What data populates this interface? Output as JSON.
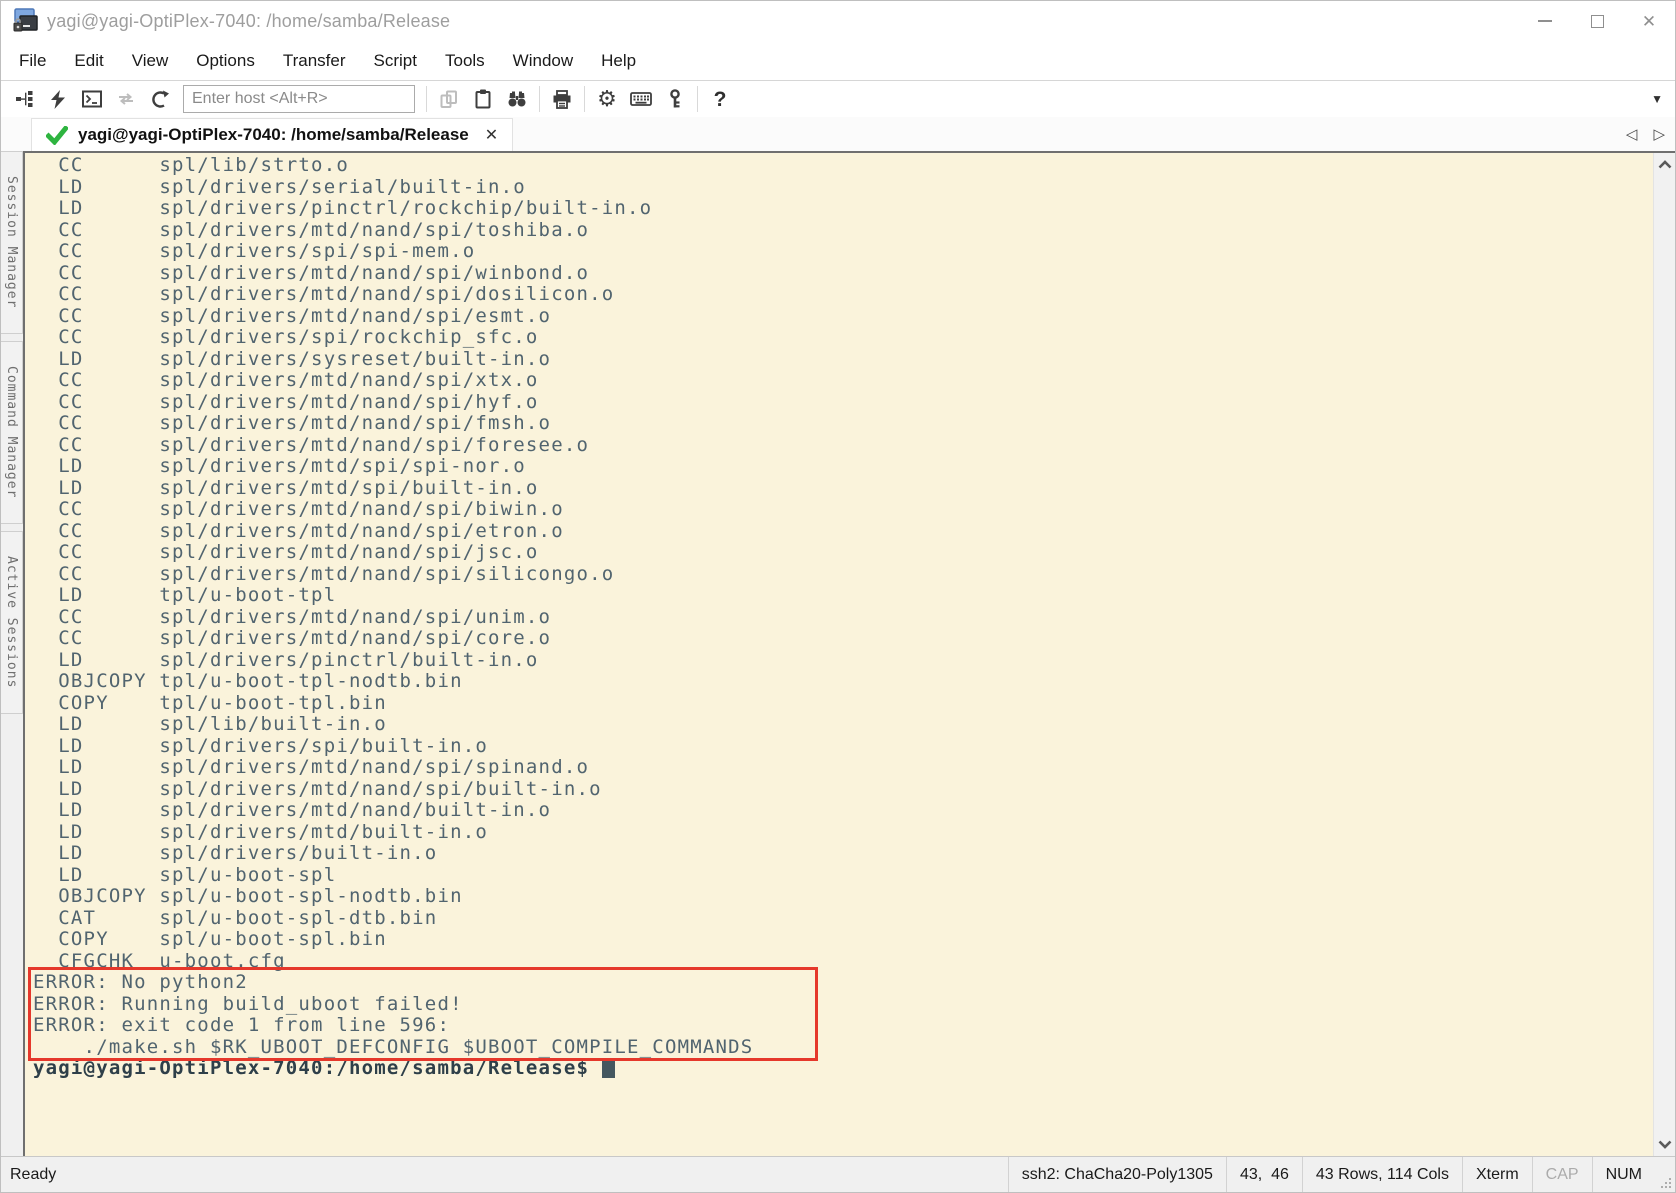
{
  "window": {
    "title": "yagi@yagi-OptiPlex-7040: /home/samba/Release"
  },
  "menu": {
    "items": [
      "File",
      "Edit",
      "View",
      "Options",
      "Transfer",
      "Script",
      "Tools",
      "Window",
      "Help"
    ]
  },
  "toolbar": {
    "host_placeholder": "Enter host <Alt+R>",
    "icons": [
      "sessions-dialog",
      "quick-connect",
      "new-terminal",
      "reconnect",
      "disconnect",
      "copy",
      "paste",
      "find",
      "print",
      "session-properties-gear",
      "keyboard-input",
      "key-agent",
      "help"
    ]
  },
  "tabbar": {
    "active_tab": {
      "label": "yagi@yagi-OptiPlex-7040: /home/samba/Release",
      "status": "connected"
    }
  },
  "sidebar": {
    "items": [
      {
        "label": "Session Manager"
      },
      {
        "label": "Command Manager"
      },
      {
        "label": "Active Sessions"
      }
    ]
  },
  "terminal": {
    "build_lines": [
      "  CC      spl/lib/strto.o",
      "  LD      spl/drivers/serial/built-in.o",
      "  LD      spl/drivers/pinctrl/rockchip/built-in.o",
      "  CC      spl/drivers/mtd/nand/spi/toshiba.o",
      "  CC      spl/drivers/spi/spi-mem.o",
      "  CC      spl/drivers/mtd/nand/spi/winbond.o",
      "  CC      spl/drivers/mtd/nand/spi/dosilicon.o",
      "  CC      spl/drivers/mtd/nand/spi/esmt.o",
      "  CC      spl/drivers/spi/rockchip_sfc.o",
      "  LD      spl/drivers/sysreset/built-in.o",
      "  CC      spl/drivers/mtd/nand/spi/xtx.o",
      "  CC      spl/drivers/mtd/nand/spi/hyf.o",
      "  CC      spl/drivers/mtd/nand/spi/fmsh.o",
      "  CC      spl/drivers/mtd/nand/spi/foresee.o",
      "  LD      spl/drivers/mtd/spi/spi-nor.o",
      "  LD      spl/drivers/mtd/spi/built-in.o",
      "  CC      spl/drivers/mtd/nand/spi/biwin.o",
      "  CC      spl/drivers/mtd/nand/spi/etron.o",
      "  CC      spl/drivers/mtd/nand/spi/jsc.o",
      "  CC      spl/drivers/mtd/nand/spi/silicongo.o",
      "  LD      tpl/u-boot-tpl",
      "  CC      spl/drivers/mtd/nand/spi/unim.o",
      "  CC      spl/drivers/mtd/nand/spi/core.o",
      "  LD      spl/drivers/pinctrl/built-in.o",
      "  OBJCOPY tpl/u-boot-tpl-nodtb.bin",
      "  COPY    tpl/u-boot-tpl.bin",
      "  LD      spl/lib/built-in.o",
      "  LD      spl/drivers/spi/built-in.o",
      "  LD      spl/drivers/mtd/nand/spi/spinand.o",
      "  LD      spl/drivers/mtd/nand/spi/built-in.o",
      "  LD      spl/drivers/mtd/nand/built-in.o",
      "  LD      spl/drivers/mtd/built-in.o",
      "  LD      spl/drivers/built-in.o",
      "  LD      spl/u-boot-spl",
      "  OBJCOPY spl/u-boot-spl-nodtb.bin",
      "  CAT     spl/u-boot-spl-dtb.bin",
      "  COPY    spl/u-boot-spl.bin",
      "  CFGCHK  u-boot.cfg"
    ],
    "error_lines": [
      "ERROR: No python2",
      "ERROR: Running build_uboot failed!",
      "ERROR: exit code 1 from line 596:",
      "    ./make.sh $RK_UBOOT_DEFCONFIG $UBOOT_COMPILE_COMMANDS"
    ],
    "prompt": "yagi@yagi-OptiPlex-7040:/home/samba/Release$",
    "colors": {
      "background": "#FAF3DB",
      "text": "#51646F",
      "prompt_text": "#2E3F49",
      "error_box_border": "#E5382B",
      "cursor": "#44575F"
    }
  },
  "statusbar": {
    "ready": "Ready",
    "encryption": "ssh2: ChaCha20-Poly1305",
    "cursor_position": "43,  46",
    "terminal_size": "43 Rows, 114 Cols",
    "emulation": "Xterm",
    "caps_lock": "CAP",
    "num_lock": "NUM"
  }
}
